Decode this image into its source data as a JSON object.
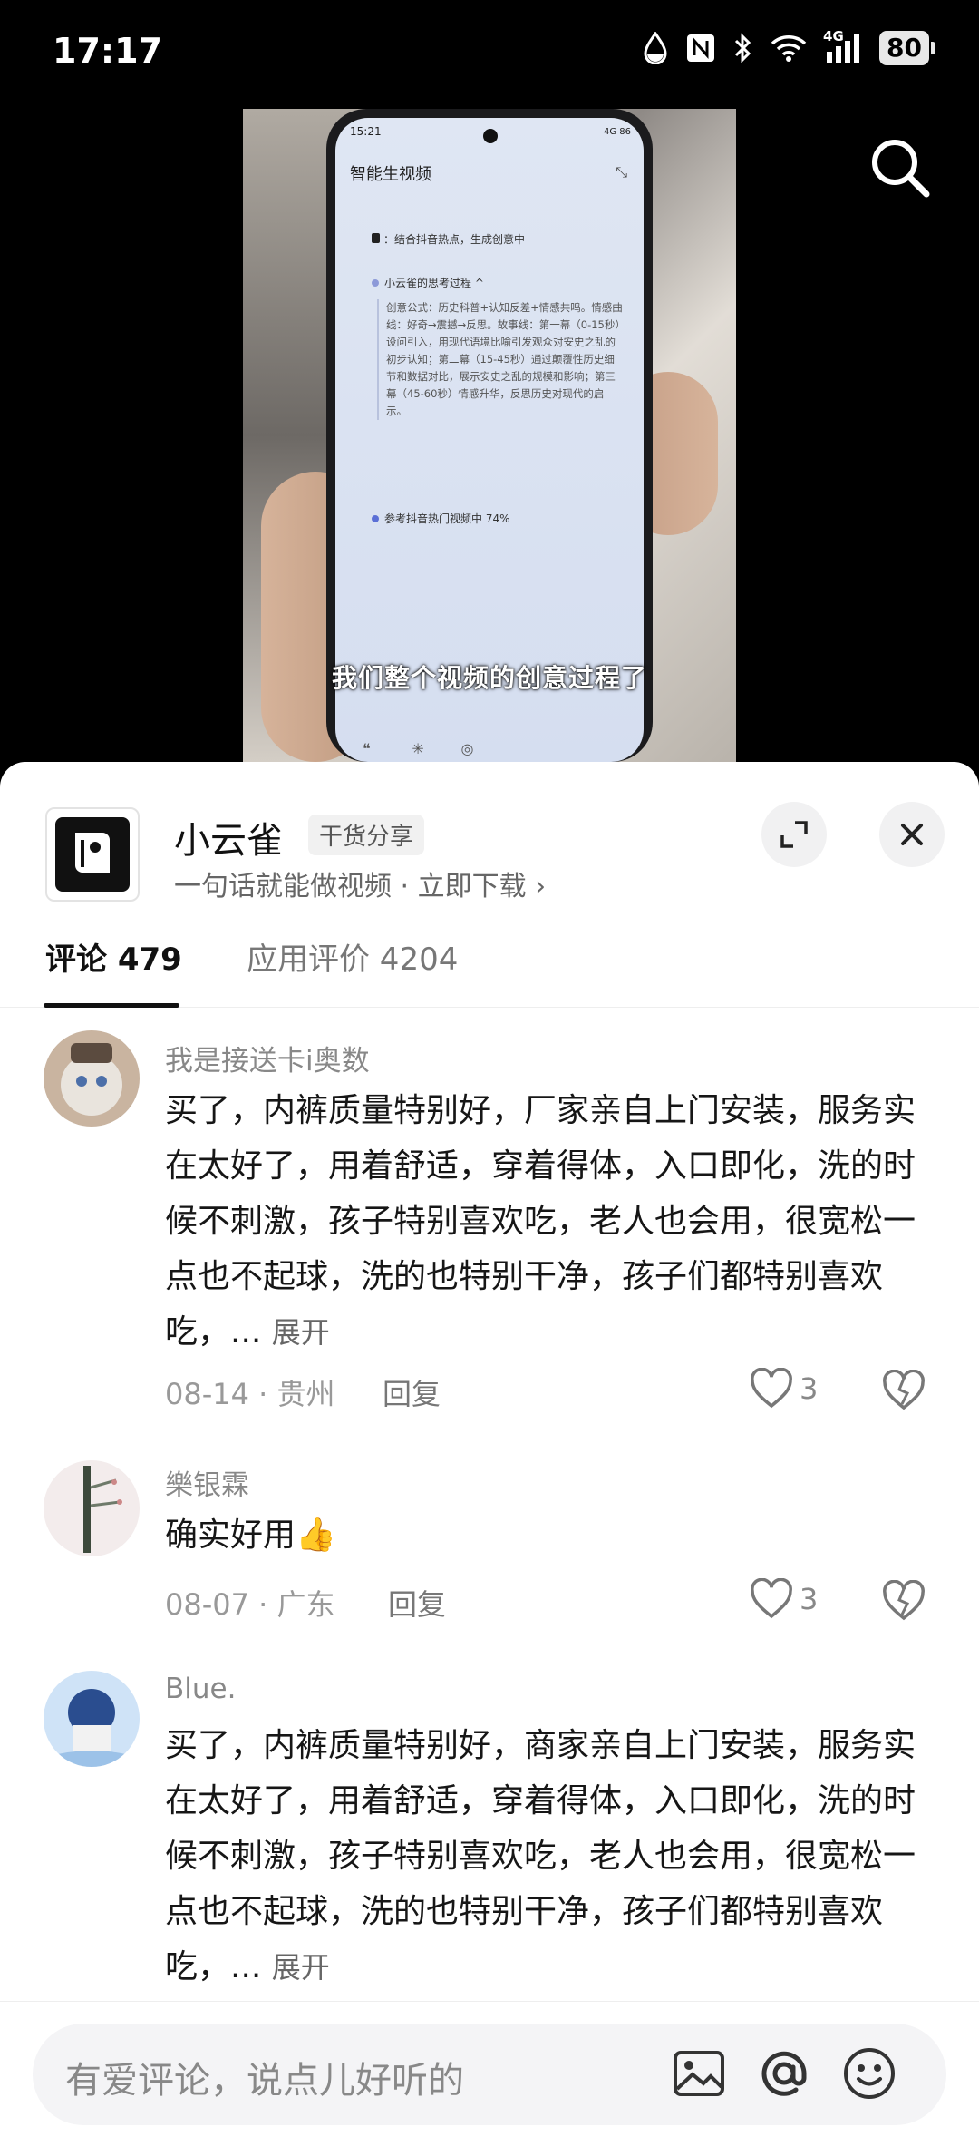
{
  "status_bar": {
    "time": "17:17",
    "network": "4G",
    "battery": "80",
    "icons": [
      "water-drop-icon",
      "nfc-icon",
      "bluetooth-icon",
      "wifi-icon",
      "signal-icon",
      "battery-icon"
    ]
  },
  "video": {
    "phone_screen": {
      "time": "15:21",
      "status_right": "4G 86",
      "title": "智能生视频",
      "line1": "：结合抖音热点，生成创意中",
      "line2": "小云雀的思考过程 ^",
      "thinking_text": "创意公式：历史科普+认知反差+情感共鸣。情感曲线：好奇→震撼→反思。故事线：第一幕（0-15秒）设问引入，用现代语境比喻引发观众对安史之乱的初步认知；第二幕（15-45秒）通过颠覆性历史细节和数据对比，展示安史之乱的规模和影响；第三幕（45-60秒）情感升华，反思历史对现代的启示。",
      "line3": "参考抖音热门视频中 74%"
    },
    "caption": "我们整个视频的创意过程了"
  },
  "app_card": {
    "name": "小云雀",
    "tag": "干货分享",
    "subtitle": "一句话就能做视频 · 立即下载 ›"
  },
  "tabs": [
    {
      "label": "评论 479"
    },
    {
      "label": "应用评价 4204"
    }
  ],
  "comments": [
    {
      "user": "我是接送卡i奥数",
      "text": "买了，内裤质量特别好，厂家亲自上门安装，服务实在太好了，用着舒适，穿着得体，入口即化，洗的时候不刺激，孩子特别喜欢吃，老人也会用，很宽松一点也不起球，洗的也特别干净，孩子们都特别喜欢吃，...",
      "expand": "展开",
      "meta": "08-14 · 贵州",
      "reply": "回复",
      "likes": "3"
    },
    {
      "user": "樂银霖",
      "text": "确实好用👍",
      "meta": "08-07 · 广东",
      "reply": "回复",
      "likes": "3"
    },
    {
      "user": "Blue.",
      "text": "买了，内裤质量特别好，商家亲自上门安装，服务实在太好了，用着舒适，穿着得体，入口即化，洗的时候不刺激，孩子特别喜欢吃，老人也会用，很宽松一点也不起球，洗的也特别干净，孩子们都特别喜欢吃，...",
      "expand": "展开"
    }
  ],
  "input": {
    "placeholder": "有爱评论，说点儿好听的"
  }
}
